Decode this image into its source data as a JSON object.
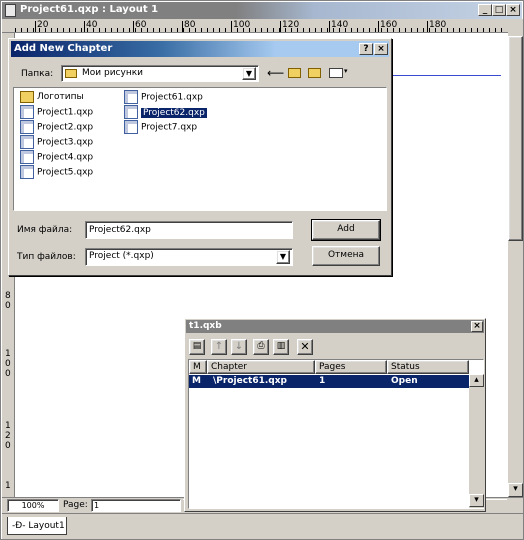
{
  "main_window": {
    "title": "Project61.qxp : Layout 1"
  },
  "top_ruler": {
    "ticks": [
      "20",
      "40",
      "60",
      "80",
      "100",
      "120",
      "140",
      "160",
      "180"
    ]
  },
  "left_ruler": {
    "ticks": [
      "8",
      "0",
      "1",
      "0",
      "0",
      "1",
      "2",
      "0",
      "1"
    ]
  },
  "status_bar": {
    "zoom": "100%",
    "page_label": "Page:",
    "page_value": "1"
  },
  "layout_tab": {
    "label": "Layout1"
  },
  "dialog": {
    "title": "Add New Chapter",
    "help_button": "?",
    "close_button": "×",
    "folder_label": "Папка:",
    "folder_value": "Мои рисунки",
    "files": [
      {
        "name": "Логотипы",
        "type": "folder"
      },
      {
        "name": "Project1.qxp",
        "type": "file"
      },
      {
        "name": "Project2.qxp",
        "type": "file"
      },
      {
        "name": "Project3.qxp",
        "type": "file"
      },
      {
        "name": "Project4.qxp",
        "type": "file"
      },
      {
        "name": "Project5.qxp",
        "type": "file"
      },
      {
        "name": "Project61.qxp",
        "type": "file"
      },
      {
        "name": "Project62.qxp",
        "type": "file",
        "selected": true
      },
      {
        "name": "Project7.qxp",
        "type": "file"
      }
    ],
    "filename_label": "Имя файла:",
    "filename_value": "Project62.qxp",
    "filetype_label": "Тип файлов:",
    "filetype_value": "Project (*.qxp)",
    "add_button": "Add",
    "cancel_button": "Отмена"
  },
  "book_palette": {
    "title": "t1.qxb",
    "columns": [
      "M",
      "Chapter",
      "Pages",
      "Status"
    ],
    "rows": [
      {
        "m": "M",
        "chapter": "\\Project61.qxp",
        "pages": "1",
        "status": "Open"
      }
    ]
  },
  "colors": {
    "title_active": "#0a246a",
    "title_inactive": "#808080",
    "face": "#d4d0c8",
    "selection": "#0a246a"
  }
}
